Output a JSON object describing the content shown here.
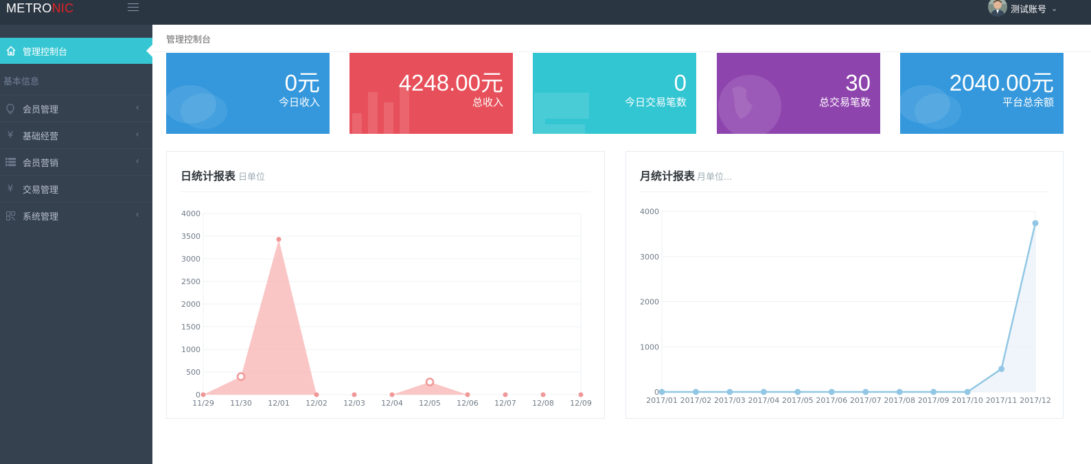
{
  "brand": {
    "part1": "METRO",
    "part2": "NIC",
    "accent": "#e02222"
  },
  "header": {
    "username": "测试账号"
  },
  "breadcrumb": "管理控制台",
  "sidebar": {
    "active": "管理控制台",
    "heading": "基本信息",
    "items": [
      {
        "label": "会员管理",
        "icon": "lightbulb-icon",
        "has_arrow": true
      },
      {
        "label": "基础经营",
        "icon": "yen-icon",
        "has_arrow": true
      },
      {
        "label": "会员营销",
        "icon": "list-icon",
        "has_arrow": true
      },
      {
        "label": "交易管理",
        "icon": "yen-icon",
        "has_arrow": false
      },
      {
        "label": "系统管理",
        "icon": "qrcode-icon",
        "has_arrow": true
      }
    ]
  },
  "stats": [
    {
      "number": "0元",
      "label": "今日收入",
      "color": "#3598dc",
      "icon": "comments-icon"
    },
    {
      "number": "4248.00元",
      "label": "总收入",
      "color": "#e7505a",
      "icon": "bar-chart-icon"
    },
    {
      "number": "0",
      "label": "今日交易笔数",
      "color": "#32c5d2",
      "icon": "shopping-cart-icon"
    },
    {
      "number": "30",
      "label": "总交易笔数",
      "color": "#8e44ad",
      "icon": "globe-icon"
    },
    {
      "number": "2040.00元",
      "label": "平台总余额",
      "color": "#3598dc",
      "icon": "comments-icon"
    }
  ],
  "panels": {
    "daily": {
      "title": "日统计报表",
      "subtitle": "日单位"
    },
    "monthly": {
      "title": "月统计报表",
      "subtitle": "月单位..."
    }
  },
  "chart_data": [
    {
      "type": "area",
      "categories": [
        "11/29",
        "11/30",
        "12/01",
        "12/02",
        "12/03",
        "12/04",
        "12/05",
        "12/06",
        "12/07",
        "12/08",
        "12/09"
      ],
      "values": [
        0,
        400,
        3430,
        0,
        0,
        0,
        280,
        0,
        0,
        0,
        0
      ],
      "ylim": [
        0,
        4000
      ],
      "yticks": [
        0,
        500,
        1000,
        1500,
        2000,
        2500,
        3000,
        3500,
        4000
      ],
      "color": "#f7a7a6",
      "grid": true
    },
    {
      "type": "line",
      "categories": [
        "2017/01",
        "2017/02",
        "2017/03",
        "2017/04",
        "2017/05",
        "2017/06",
        "2017/07",
        "2017/08",
        "2017/09",
        "2017/10",
        "2017/11",
        "2017/12"
      ],
      "values": [
        0,
        0,
        0,
        0,
        0,
        0,
        0,
        0,
        0,
        0,
        510,
        3740
      ],
      "ylim": [
        0,
        4000
      ],
      "yticks": [
        0,
        1000,
        2000,
        3000,
        4000
      ],
      "color": "#91c7e4",
      "grid": true
    }
  ]
}
